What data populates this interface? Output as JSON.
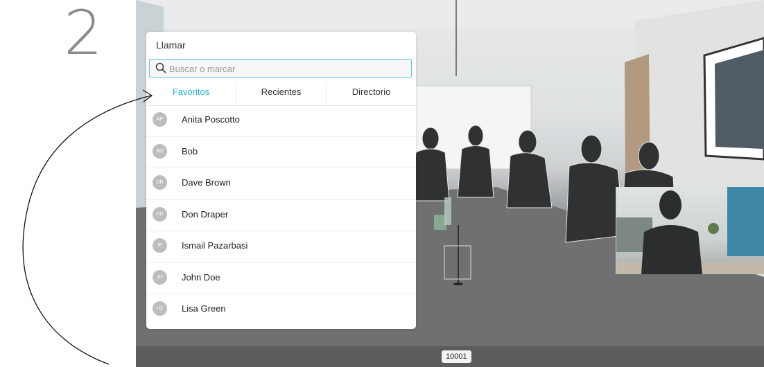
{
  "step": {
    "number": "2"
  },
  "call_panel": {
    "title": "Llamar",
    "search": {
      "placeholder": "Buscar o marcar",
      "value": "",
      "icon": "search-icon"
    },
    "tabs": [
      {
        "label": "Favoritos",
        "active": true
      },
      {
        "label": "Recientes",
        "active": false
      },
      {
        "label": "Directorio",
        "active": false
      }
    ],
    "contacts": [
      {
        "initials": "AP",
        "name": "Anita Poscotto"
      },
      {
        "initials": "BO",
        "name": "Bob"
      },
      {
        "initials": "DB",
        "name": "Dave Brown"
      },
      {
        "initials": "DD",
        "name": "Don Draper"
      },
      {
        "initials": "IP",
        "name": "Ismail Pazarbasi"
      },
      {
        "initials": "JD",
        "name": "John Doe"
      },
      {
        "initials": "LG",
        "name": "Lisa Green"
      }
    ]
  },
  "call_id": "10001",
  "colors": {
    "accent": "#1fb4e5",
    "search_border": "#62c5e6",
    "avatar_bg": "#bdbdbd",
    "step_number": "#8a8a8a"
  }
}
